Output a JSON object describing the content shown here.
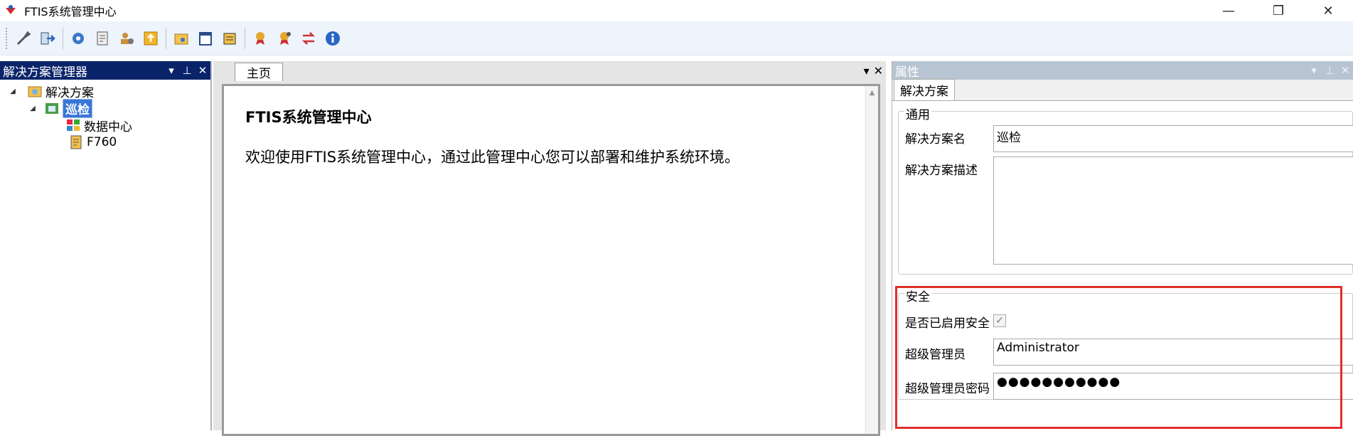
{
  "window": {
    "title": "FTIS系统管理中心",
    "minimize": "—",
    "restore": "❐",
    "close": "✕"
  },
  "solution_explorer": {
    "title": "解决方案管理器",
    "tree": [
      {
        "label": "解决方案",
        "level": 0,
        "expanded": true
      },
      {
        "label": "巡检",
        "level": 1,
        "expanded": true,
        "selected": true
      },
      {
        "label": "数据中心",
        "level": 2
      },
      {
        "label": "F760",
        "level": 2
      }
    ]
  },
  "document": {
    "tab_label": "主页",
    "heading": "FTIS系统管理中心",
    "body": "欢迎使用FTIS系统管理中心，通过此管理中心您可以部署和维护系统环境。"
  },
  "properties": {
    "title": "属性",
    "tab_label": "解决方案",
    "general": {
      "title": "通用",
      "name_label": "解决方案名",
      "name_value": "巡检",
      "desc_label": "解决方案描述",
      "desc_value": ""
    },
    "security": {
      "title": "安全",
      "enabled_label": "是否已启用安全",
      "enabled": true,
      "admin_label": "超级管理员",
      "admin_value": "Administrator",
      "password_label": "超级管理员密码",
      "password_value": "●●●●●●●●●●●"
    }
  },
  "colors": {
    "highlight": "#e0302c",
    "panel_header": "#0a246a",
    "selection": "#3875d7"
  }
}
